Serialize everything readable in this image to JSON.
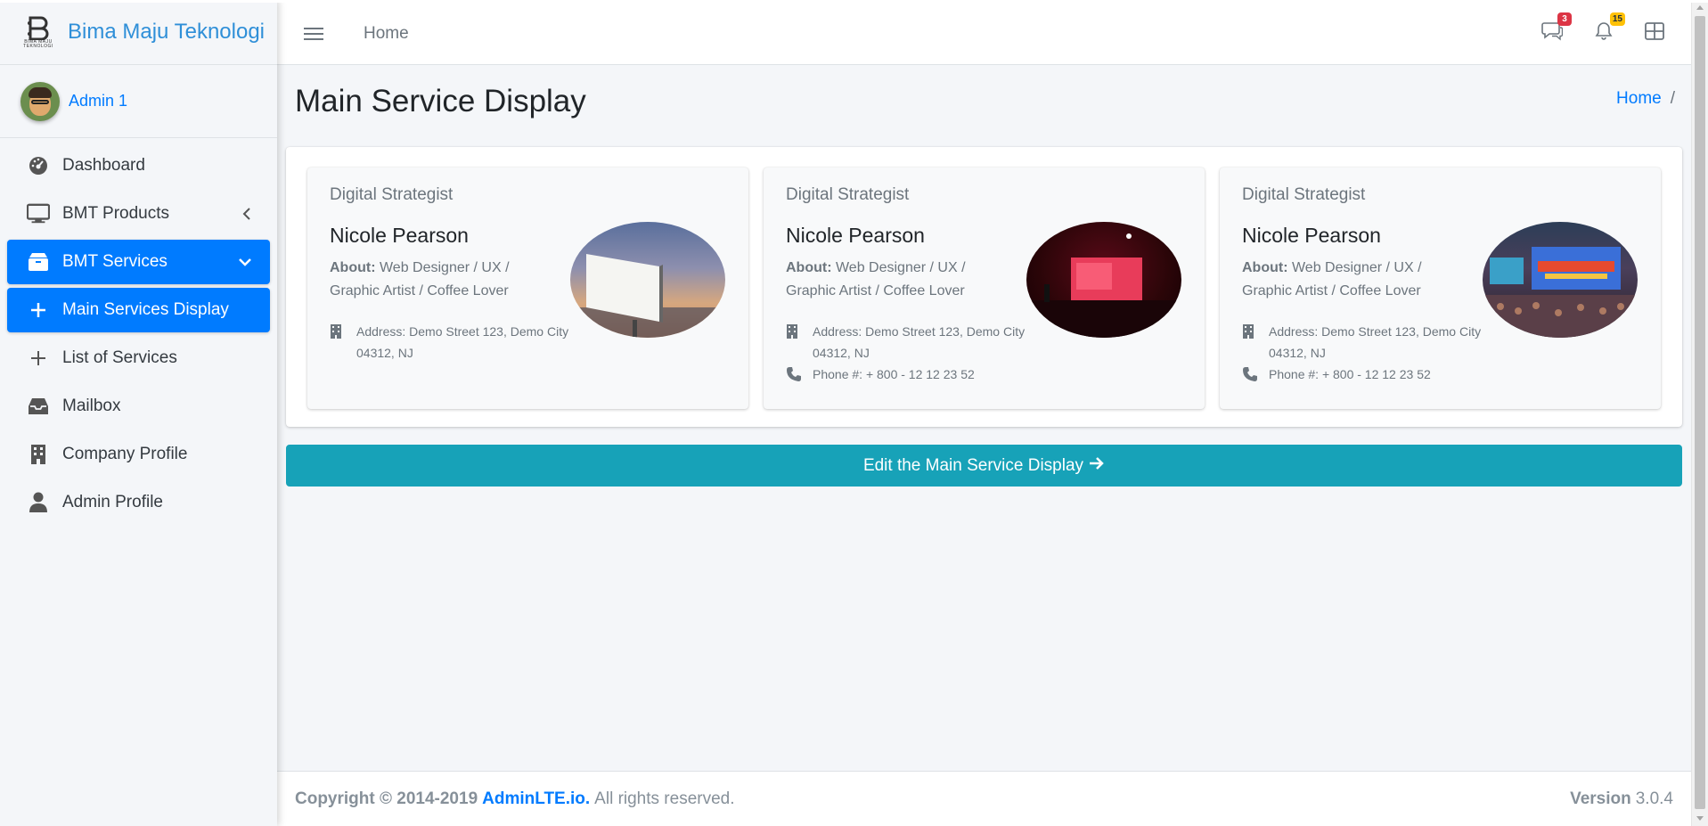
{
  "brand": {
    "name": "Bima Maju Teknologi",
    "logo_text": "BIMA MAJU TEKNOLOGI",
    "logo_icon": "bmt-logo-icon"
  },
  "user": {
    "name": "Admin 1"
  },
  "sidebar": {
    "items": [
      {
        "label": "Dashboard",
        "icon": "tachometer-icon"
      },
      {
        "label": "BMT Products",
        "icon": "desktop-icon"
      },
      {
        "label": "BMT Services",
        "icon": "box-icon"
      },
      {
        "label": "Main Services Display",
        "icon": "plus-icon"
      },
      {
        "label": "List of Services",
        "icon": "plus-icon"
      },
      {
        "label": "Mailbox",
        "icon": "inbox-icon"
      },
      {
        "label": "Company Profile",
        "icon": "building-icon"
      },
      {
        "label": "Admin Profile",
        "icon": "user-icon"
      }
    ]
  },
  "topbar": {
    "home": "Home",
    "messages_badge": "3",
    "notifications_badge": "15"
  },
  "page": {
    "title": "Main Service Display",
    "breadcrumb_home": "Home",
    "breadcrumb_sep": "/"
  },
  "cards": [
    {
      "header": "Digital Strategist",
      "name": "Nicole Pearson",
      "about_label": "About:",
      "about": "Web Designer / UX / Graphic Artist / Coffee Lover",
      "address": "Address: Demo Street 123, Demo City 04312, NJ",
      "phone": ""
    },
    {
      "header": "Digital Strategist",
      "name": "Nicole Pearson",
      "about_label": "About:",
      "about": "Web Designer / UX / Graphic Artist / Coffee Lover",
      "address": "Address: Demo Street 123, Demo City 04312, NJ",
      "phone": "Phone #: + 800 - 12 12 23 52"
    },
    {
      "header": "Digital Strategist",
      "name": "Nicole Pearson",
      "about_label": "About:",
      "about": "Web Designer / UX / Graphic Artist / Coffee Lover",
      "address": "Address: Demo Street 123, Demo City 04312, NJ",
      "phone": "Phone #: + 800 - 12 12 23 52"
    }
  ],
  "edit_button": {
    "label": "Edit the Main Service Display"
  },
  "footer": {
    "copyright": "Copyright © 2014-2019",
    "link": "AdminLTE.io.",
    "rest": "All rights reserved.",
    "version_label": "Version",
    "version": "3.0.4"
  },
  "colors": {
    "primary": "#007bff",
    "info": "#17a2b8",
    "danger": "#dc3545",
    "warning": "#ffc107"
  }
}
